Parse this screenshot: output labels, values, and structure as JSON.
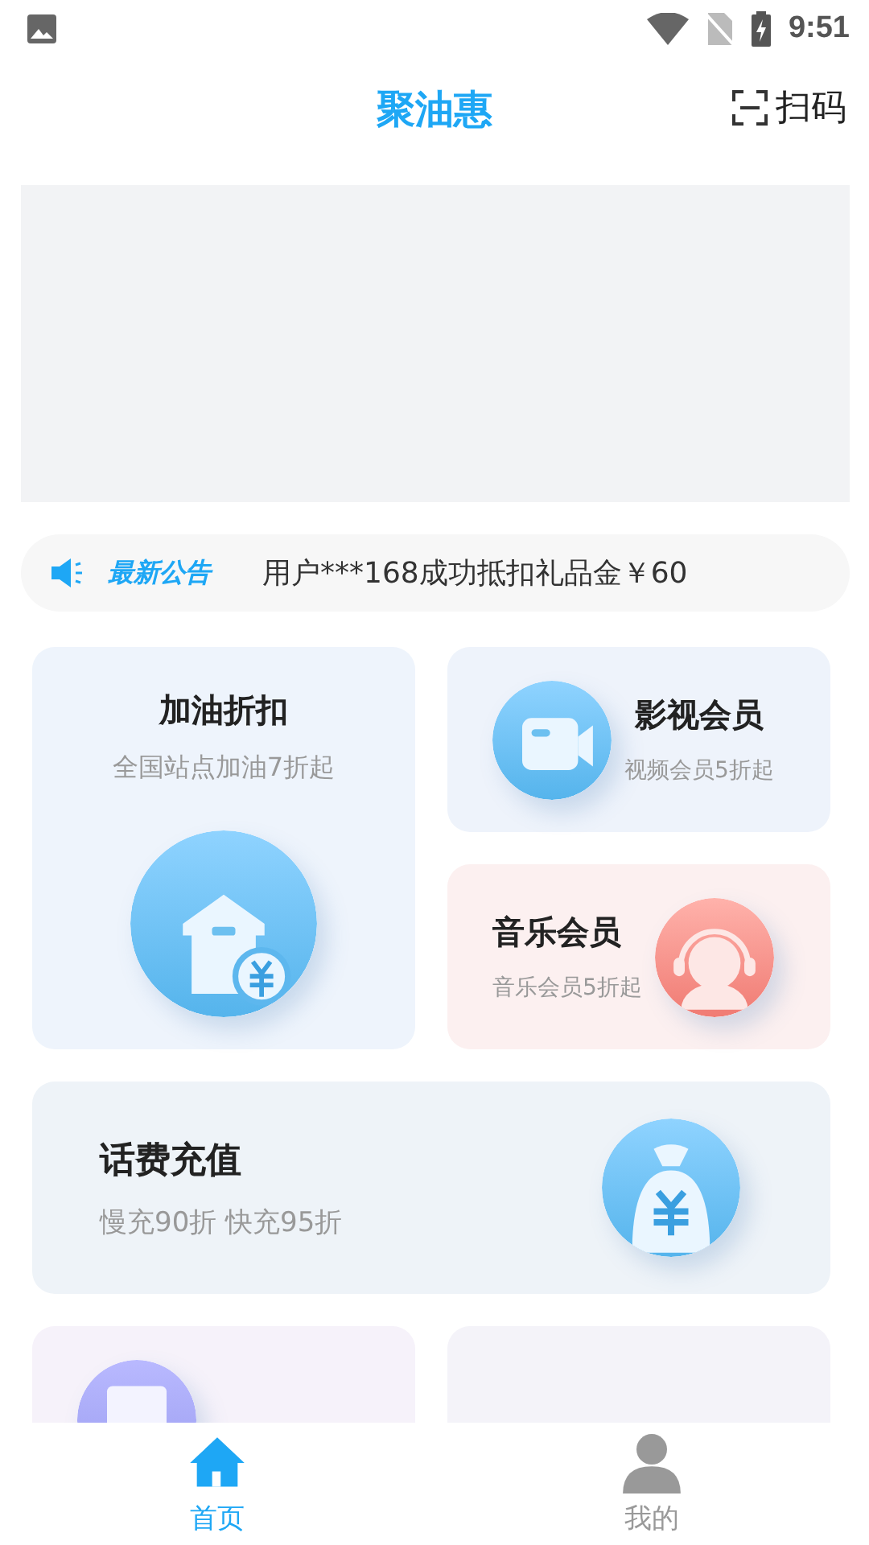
{
  "status_bar": {
    "time": "9:51"
  },
  "header": {
    "title": "聚油惠",
    "scan_label": "扫码"
  },
  "notice": {
    "label": "最新公告",
    "text": "用户***168成功抵扣礼品金￥60"
  },
  "cards": [
    {
      "kind": "tall",
      "title": "加油折扣",
      "subtitle": "全国站点加油7折起",
      "color": "#eef4fc"
    },
    {
      "kind": "icon-left",
      "title": "影视会员",
      "subtitle": "视频会员5折起",
      "color": "#eef3fb"
    },
    {
      "kind": "icon-right",
      "title": "音乐会员",
      "subtitle": "音乐会员5折起",
      "color": "#fcf0f0"
    },
    {
      "kind": "wide",
      "title": "话费充值",
      "subtitle": "慢充90折 快充95折",
      "color": "#eef3f8"
    },
    {
      "kind": "icon-left",
      "color": "#f6f2fa"
    },
    {
      "kind": "center",
      "color": "#f4f3f9"
    }
  ],
  "tabs": [
    {
      "label": "首页",
      "selected": true
    },
    {
      "label": "我的",
      "selected": false
    }
  ]
}
